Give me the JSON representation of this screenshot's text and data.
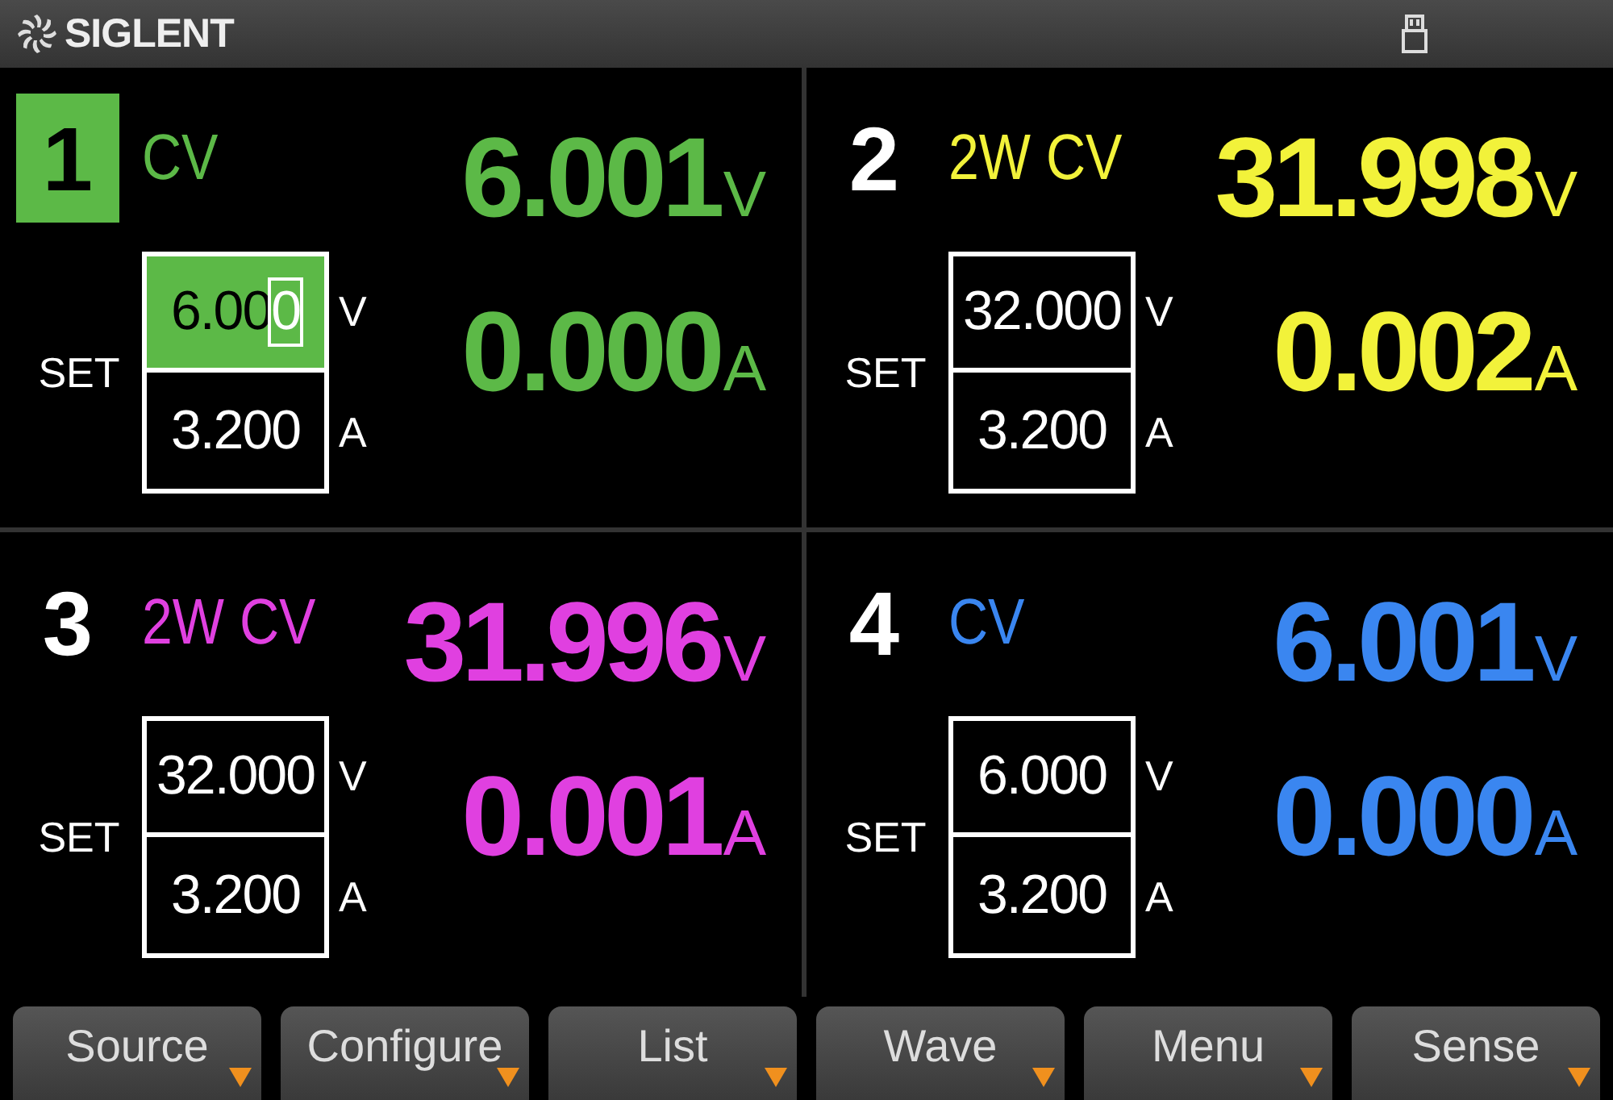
{
  "header": {
    "logo": "SIGLENT"
  },
  "channels": [
    {
      "number": "1",
      "selected": true,
      "mode": "CV",
      "color": "#5cb947",
      "voltage": "6.001",
      "voltage_unit": "V",
      "current": "0.000",
      "current_unit": "A",
      "set_label": "SET",
      "set_voltage": {
        "value": "6.000",
        "editing": true
      },
      "set_voltage_unit": "V",
      "set_current": {
        "value": "3.200",
        "editing": false
      },
      "set_current_unit": "A"
    },
    {
      "number": "2",
      "selected": false,
      "mode": "2W CV",
      "color": "#f2f23a",
      "voltage": "31.998",
      "voltage_unit": "V",
      "current": "0.002",
      "current_unit": "A",
      "set_label": "SET",
      "set_voltage": {
        "value": "32.000",
        "editing": false
      },
      "set_voltage_unit": "V",
      "set_current": {
        "value": "3.200",
        "editing": false
      },
      "set_current_unit": "A"
    },
    {
      "number": "3",
      "selected": false,
      "mode": "2W CV",
      "color": "#e040e0",
      "voltage": "31.996",
      "voltage_unit": "V",
      "current": "0.001",
      "current_unit": "A",
      "set_label": "SET",
      "set_voltage": {
        "value": "32.000",
        "editing": false
      },
      "set_voltage_unit": "V",
      "set_current": {
        "value": "3.200",
        "editing": false
      },
      "set_current_unit": "A"
    },
    {
      "number": "4",
      "selected": false,
      "mode": "CV",
      "color": "#3a86f0",
      "voltage": "6.001",
      "voltage_unit": "V",
      "current": "0.000",
      "current_unit": "A",
      "set_label": "SET",
      "set_voltage": {
        "value": "6.000",
        "editing": false
      },
      "set_voltage_unit": "V",
      "set_current": {
        "value": "3.200",
        "editing": false
      },
      "set_current_unit": "A"
    }
  ],
  "softkeys": [
    {
      "label": "Source"
    },
    {
      "label": "Configure"
    },
    {
      "label": "List"
    },
    {
      "label": "Wave"
    },
    {
      "label": "Menu"
    },
    {
      "label": "Sense"
    }
  ]
}
